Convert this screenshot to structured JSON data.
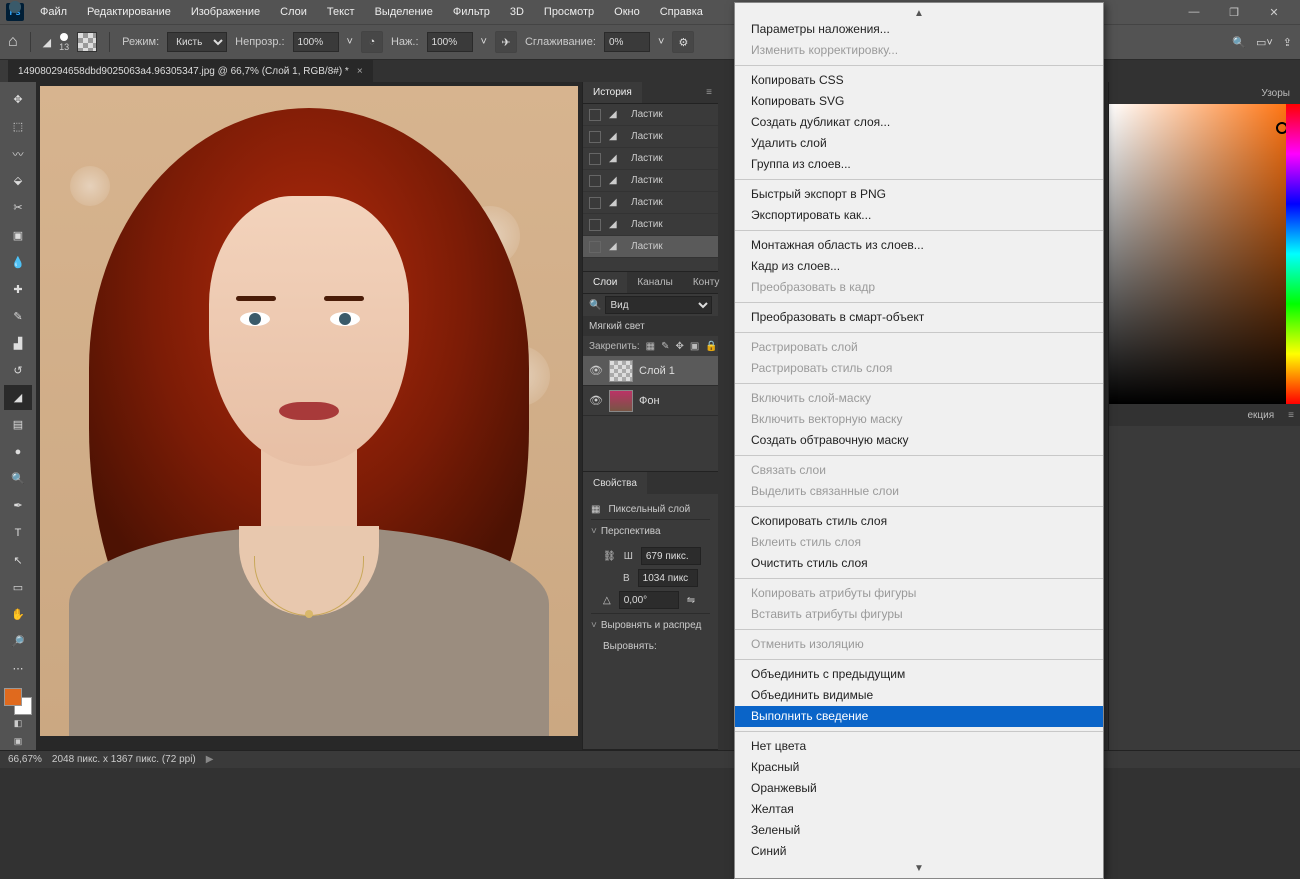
{
  "menu": {
    "items": [
      "Файл",
      "Редактирование",
      "Изображение",
      "Слои",
      "Текст",
      "Выделение",
      "Фильтр",
      "3D",
      "Просмотр",
      "Окно",
      "Справка"
    ]
  },
  "optbar": {
    "brush_size": "13",
    "mode_label": "Режим:",
    "mode_value": "Кисть",
    "opacity_label": "Непрозр.:",
    "opacity_value": "100%",
    "flow_label": "Наж.:",
    "flow_value": "100%",
    "smooth_label": "Сглаживание:",
    "smooth_value": "0%"
  },
  "doc": {
    "title": "149080294658dbd9025063a4.96305347.jpg @ 66,7% (Слой 1, RGB/8#) *"
  },
  "history": {
    "tab": "История",
    "rows": [
      "Ластик",
      "Ластик",
      "Ластик",
      "Ластик",
      "Ластик",
      "Ластик",
      "Ластик"
    ]
  },
  "layers_panel": {
    "tabs": [
      "Слои",
      "Каналы",
      "Конту"
    ],
    "kind_label": "Вид",
    "blend": "Мягкий свет",
    "lock_label": "Закрепить:",
    "layers": [
      {
        "name": "Слой 1"
      },
      {
        "name": "Фон"
      }
    ]
  },
  "props": {
    "tab": "Свойства",
    "pixel_layer": "Пиксельный слой",
    "perspective": "Перспектива",
    "w_label": "Ш",
    "w_val": "679 пикс.",
    "h_label": "В",
    "h_val": "1034 пикс",
    "angle": "0,00°",
    "align": "Выровнять и распред",
    "align_sub": "Выровнять:"
  },
  "far": {
    "tab_patterns": "Узоры",
    "tab_corr": "екция"
  },
  "ctx": {
    "items": [
      {
        "t": "Параметры наложения...",
        "d": false
      },
      {
        "t": "Изменить корректировку...",
        "d": true
      },
      {
        "sep": true
      },
      {
        "t": "Копировать CSS",
        "d": false
      },
      {
        "t": "Копировать SVG",
        "d": false
      },
      {
        "t": "Создать дубликат слоя...",
        "d": false
      },
      {
        "t": "Удалить слой",
        "d": false
      },
      {
        "t": "Группа из слоев...",
        "d": false
      },
      {
        "sep": true
      },
      {
        "t": "Быстрый экспорт в PNG",
        "d": false
      },
      {
        "t": "Экспортировать как...",
        "d": false
      },
      {
        "sep": true
      },
      {
        "t": "Монтажная область из слоев...",
        "d": false
      },
      {
        "t": "Кадр из слоев...",
        "d": false
      },
      {
        "t": "Преобразовать в кадр",
        "d": true
      },
      {
        "sep": true
      },
      {
        "t": "Преобразовать в смарт-объект",
        "d": false
      },
      {
        "sep": true
      },
      {
        "t": "Растрировать слой",
        "d": true
      },
      {
        "t": "Растрировать стиль слоя",
        "d": true
      },
      {
        "sep": true
      },
      {
        "t": "Включить слой-маску",
        "d": true
      },
      {
        "t": "Включить векторную маску",
        "d": true
      },
      {
        "t": "Создать обтравочную маску",
        "d": false
      },
      {
        "sep": true
      },
      {
        "t": "Связать слои",
        "d": true
      },
      {
        "t": "Выделить связанные слои",
        "d": true
      },
      {
        "sep": true
      },
      {
        "t": "Скопировать стиль слоя",
        "d": false
      },
      {
        "t": "Вклеить стиль слоя",
        "d": true
      },
      {
        "t": "Очистить стиль слоя",
        "d": false
      },
      {
        "sep": true
      },
      {
        "t": "Копировать атрибуты фигуры",
        "d": true
      },
      {
        "t": "Вставить атрибуты фигуры",
        "d": true
      },
      {
        "sep": true
      },
      {
        "t": "Отменить изоляцию",
        "d": true
      },
      {
        "sep": true
      },
      {
        "t": "Объединить с предыдущим",
        "d": false
      },
      {
        "t": "Объединить видимые",
        "d": false
      },
      {
        "t": "Выполнить сведение",
        "d": false,
        "hl": true
      },
      {
        "sep": true
      },
      {
        "t": "Нет цвета",
        "d": false
      },
      {
        "t": "Красный",
        "d": false
      },
      {
        "t": "Оранжевый",
        "d": false
      },
      {
        "t": "Желтая",
        "d": false
      },
      {
        "t": "Зеленый",
        "d": false
      },
      {
        "t": "Синий",
        "d": false
      }
    ]
  },
  "status": {
    "zoom": "66,67%",
    "dims": "2048 пикс. x 1367 пикс. (72 ppi)"
  }
}
